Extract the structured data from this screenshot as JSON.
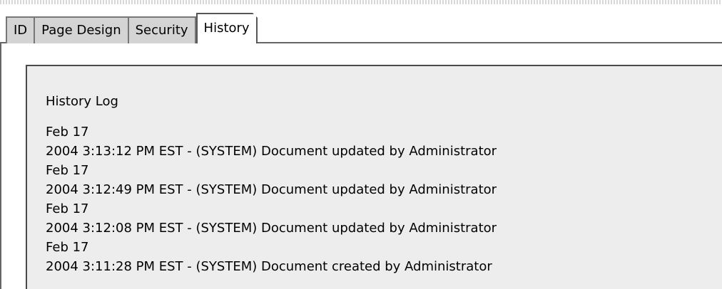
{
  "tabs": [
    {
      "label": "ID",
      "active": false
    },
    {
      "label": "Page Design",
      "active": false
    },
    {
      "label": "Security",
      "active": false
    },
    {
      "label": "History",
      "active": true
    }
  ],
  "history": {
    "title": "History Log",
    "entries": [
      {
        "date": "Feb 17",
        "text": "2004 3:13:12 PM EST - (SYSTEM) Document updated by Administrator"
      },
      {
        "date": "Feb 17",
        "text": "2004 3:12:49 PM EST - (SYSTEM) Document updated by Administrator"
      },
      {
        "date": "Feb 17",
        "text": "2004 3:12:08 PM EST - (SYSTEM) Document updated by Administrator"
      },
      {
        "date": "Feb 17",
        "text": "2004 3:11:28 PM EST - (SYSTEM) Document created by Administrator"
      }
    ]
  }
}
